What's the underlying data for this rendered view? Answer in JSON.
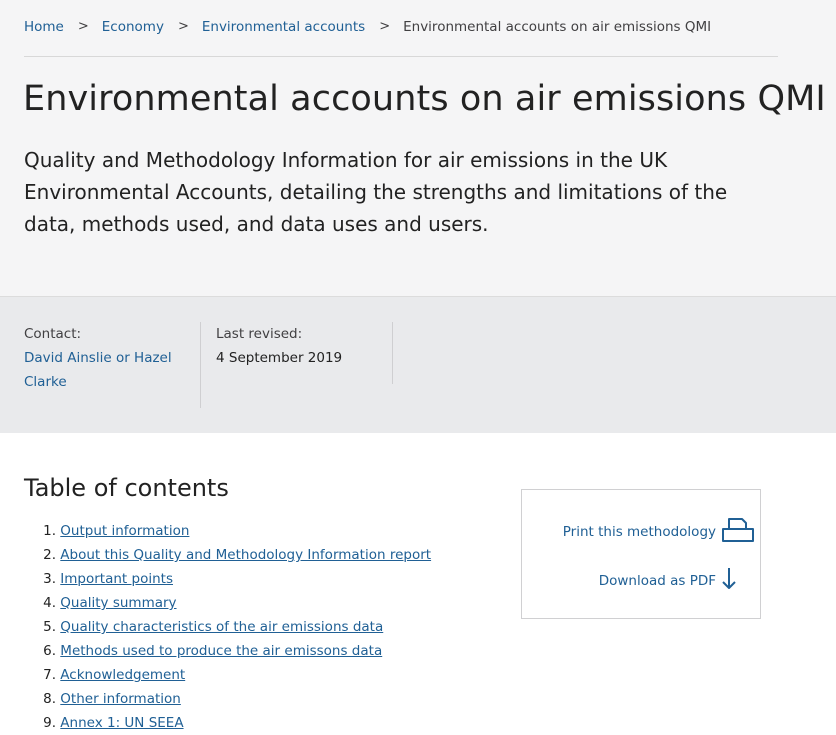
{
  "breadcrumb": {
    "items": [
      "Home",
      "Economy",
      "Environmental accounts"
    ],
    "separator": ">",
    "current": "Environmental accounts on air emissions QMI"
  },
  "page": {
    "title": "Environmental accounts on air emissions QMI",
    "summary": "Quality and Methodology Information for air emissions in the UK Environmental Accounts, detailing the strengths and limitations of the data, methods used, and data uses and users."
  },
  "meta": {
    "contact_label": "Contact:",
    "contact_value": "David Ainslie or Hazel Clarke",
    "revised_label": "Last revised:",
    "revised_value": "4 September 2019"
  },
  "toc": {
    "title": "Table of contents",
    "items": [
      {
        "num": "1.",
        "label": "Output information"
      },
      {
        "num": "2.",
        "label": "About this Quality and Methodology Information report"
      },
      {
        "num": "3.",
        "label": "Important points"
      },
      {
        "num": "4.",
        "label": "Quality summary"
      },
      {
        "num": "5.",
        "label": "Quality characteristics of the air emissions data"
      },
      {
        "num": "6.",
        "label": "Methods used to produce the air emissons data"
      },
      {
        "num": "7.",
        "label": "Acknowledgement"
      },
      {
        "num": "8.",
        "label": "Other information"
      },
      {
        "num": "9.",
        "label": "Annex 1: UN SEEA"
      }
    ]
  },
  "actions": {
    "print_label": "Print this methodology",
    "print_icon": "printer-icon",
    "pdf_label": "Download as PDF",
    "pdf_icon": "download-arrow-icon"
  },
  "colors": {
    "link": "#206095",
    "header_bg": "#f5f5f6",
    "meta_bg": "#e9eaec",
    "text": "#222222"
  }
}
